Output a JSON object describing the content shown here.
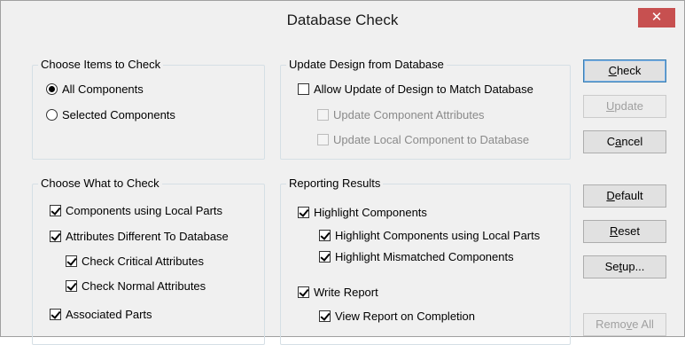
{
  "window": {
    "title": "Database Check",
    "close_label": "✕"
  },
  "items_to_check": {
    "legend": "Choose Items to Check",
    "options": [
      {
        "label": "All Components",
        "selected": true
      },
      {
        "label": "Selected Components",
        "selected": false
      }
    ]
  },
  "update_design": {
    "legend": "Update Design from Database",
    "allow_label": "Allow Update of Design to Match Database",
    "attrs_label": "Update Component Attributes",
    "local_label": "Update Local Component to Database"
  },
  "what_to_check": {
    "legend": "Choose What to Check",
    "local_parts": "Components using Local Parts",
    "attr_diff": "Attributes Different To Database",
    "critical": "Check Critical Attributes",
    "normal": "Check Normal Attributes",
    "associated": "Associated Parts"
  },
  "reporting": {
    "legend": "Reporting Results",
    "highlight": "Highlight Components",
    "highlight_local": "Highlight Components using Local Parts",
    "highlight_mismatch": "Highlight Mismatched Components",
    "write_report": "Write Report",
    "view_report": "View Report on Completion"
  },
  "buttons": {
    "check": {
      "mnemonic": "C",
      "rest": "heck"
    },
    "update": {
      "mnemonic": "U",
      "rest": "pdate"
    },
    "cancel": {
      "mnemonic": "a",
      "pre": "C",
      "rest": "ncel"
    },
    "default": {
      "mnemonic": "D",
      "rest": "efault"
    },
    "reset": {
      "mnemonic": "R",
      "rest": "eset"
    },
    "setup": {
      "pre": "Se",
      "mnemonic": "t",
      "rest": "up..."
    },
    "remove_all": {
      "pre": "Remo",
      "mnemonic": "v",
      "rest": "e All"
    }
  }
}
